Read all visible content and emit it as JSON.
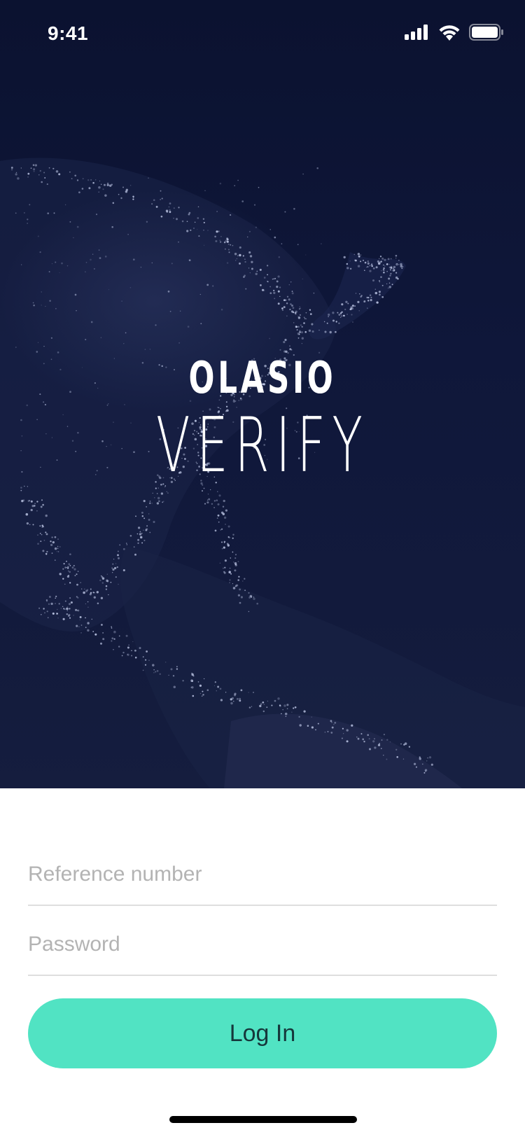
{
  "status_bar": {
    "time": "9:41",
    "icons": [
      "cellular-signal-icon",
      "wifi-icon",
      "battery-icon"
    ]
  },
  "brand": {
    "name": "OLASIO",
    "product": "VERIFY",
    "background": "night-earth-map"
  },
  "form": {
    "reference": {
      "placeholder": "Reference number",
      "value": ""
    },
    "password": {
      "placeholder": "Password",
      "value": ""
    },
    "login_label": "Log In"
  },
  "colors": {
    "hero_background": "#0f173a",
    "accent": "#51e3c3",
    "button_text": "#16373b",
    "placeholder": "#b3b3b3"
  }
}
